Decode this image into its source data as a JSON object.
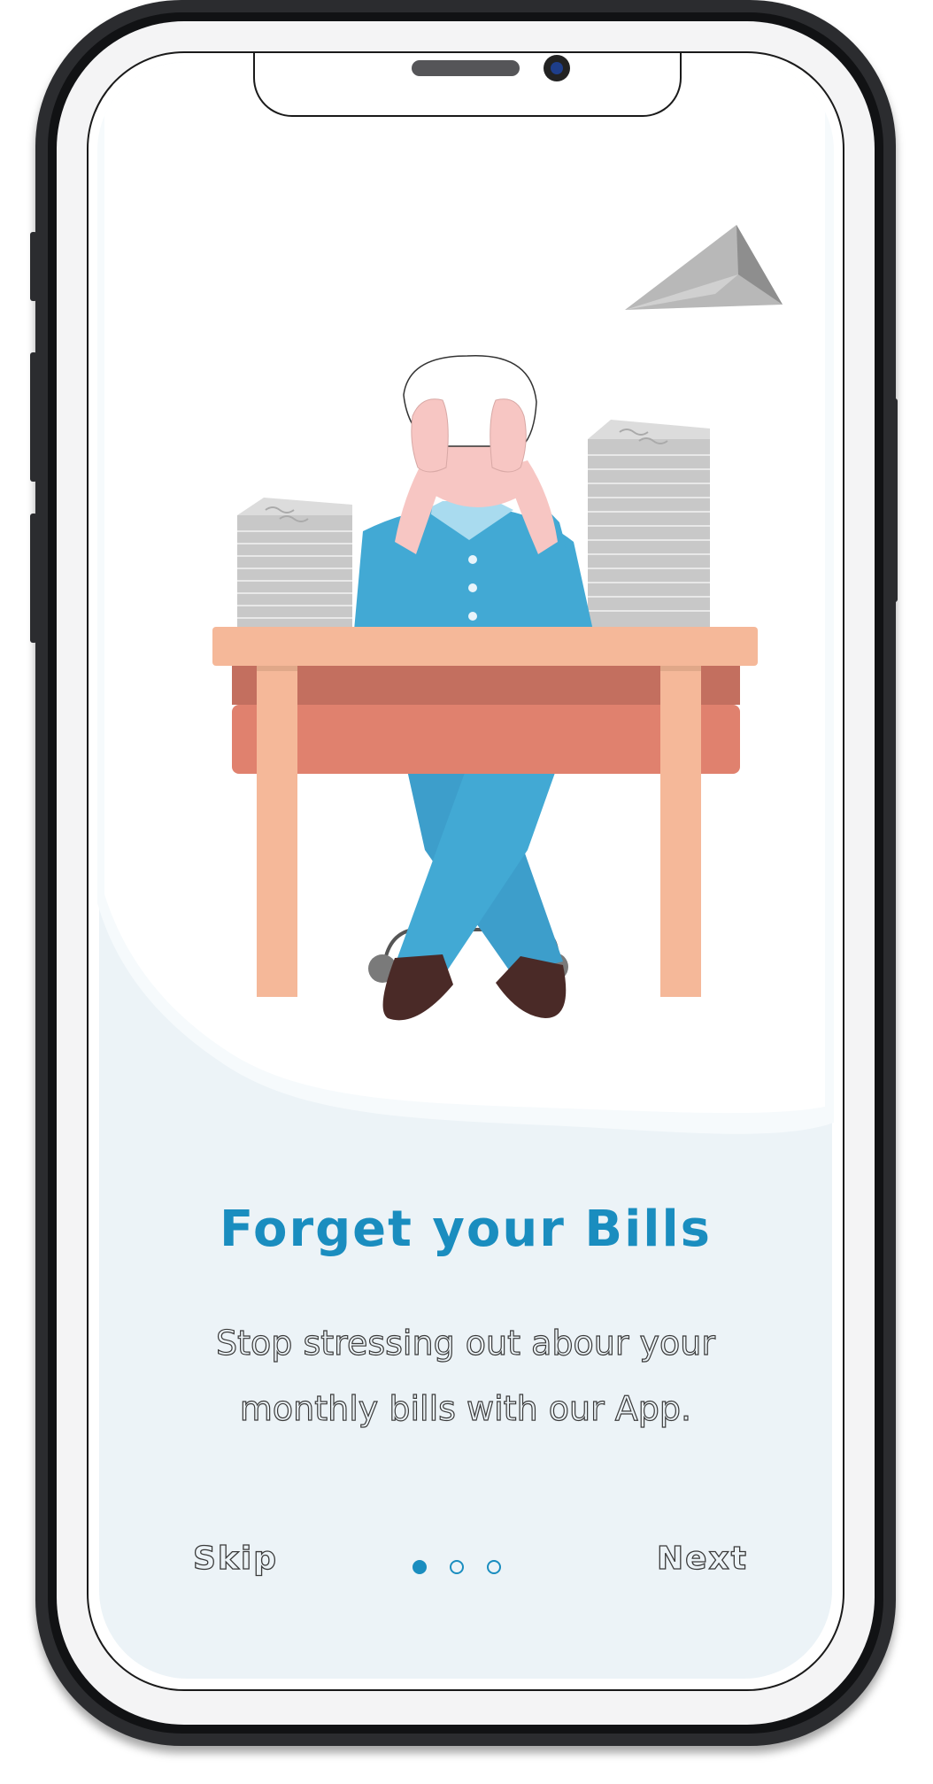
{
  "onboarding": {
    "title": "Forget your Bills",
    "subtitle_line1": "Stop stressing out abour your",
    "subtitle_line2": "monthly bills with our App.",
    "skip_label": "Skip",
    "next_label": "Next",
    "pagination": {
      "total": 3,
      "active_index": 0
    }
  },
  "colors": {
    "accent": "#1a8dbf",
    "screen_background": "#ecf3f7",
    "phone_frame": "#2b2c2f",
    "desk_top": "#f5b899",
    "desk_drawer": "#e0816e",
    "shirt": "#42a9d4",
    "skin": "#f7c6c3"
  }
}
